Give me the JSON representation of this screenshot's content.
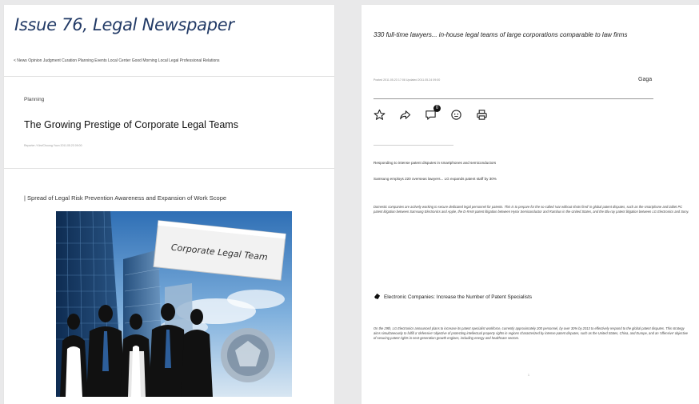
{
  "left": {
    "issue_title": "Issue 76, Legal Newspaper",
    "nav": "< News Opinion Judgment Curation Planning Events Local Center Good Morning Local Legal Professional Relations",
    "section": "Planning",
    "title": "The Growing Prestige of Corporate Legal Teams",
    "reporter": "Reporter / Kim/Choong Yoon 2011.05.23 09:00",
    "subhead": "| Spread of Legal Risk Prevention Awareness and Expansion of Work Scope",
    "illustration_sign": "Corporate Legal Team"
  },
  "right": {
    "headline": "330 full-time lawyers... in-house legal teams of large corporations comparable to law firms",
    "date": "Posted 2011.05.23 17:08 Updated 2011.05.24 09:00",
    "author": "Gaga",
    "actions": [
      {
        "icon": "star-icon"
      },
      {
        "icon": "share-icon"
      },
      {
        "icon": "comment-icon",
        "badge": "0"
      },
      {
        "icon": "emoji-icon"
      },
      {
        "icon": "print-icon"
      }
    ],
    "line1": "Responding to intense patent disputes in smartphones and semiconductors",
    "line2": "Samsung employs 220 overseas lawyers... LG expands patent staff by 30%",
    "para1": "Domestic companies are actively working to secure dedicated legal personnel for patents. This is to prepare for the so-called 'war without shots fired' in global patent disputes, such as the smartphone and tablet PC patent litigation between Samsung Electronics and Apple, the D-RAM patent litigation between Hynix Semiconductor and Rambus in the United States, and the Blu-ray patent litigation between LG Electronics and Sony.",
    "subsection": "Electronic Companies: Increase the Number of Patent Specialists",
    "para2": "On the 29th, LG Electronics announced plans to increase its patent specialist workforce, currently approximately 200 personnel, by over 30% by 2013 to effectively respond to the global patent disputes. This strategy aims simultaneously to fulfill a 'defensive' objective of protecting intellectual property rights in regions characterized by intense patent disputes, such as the United States, China, and Europe, and an 'offensive' objective of securing patent rights in next-generation growth engines, including energy and healthcare sectors.",
    "page": "1"
  }
}
